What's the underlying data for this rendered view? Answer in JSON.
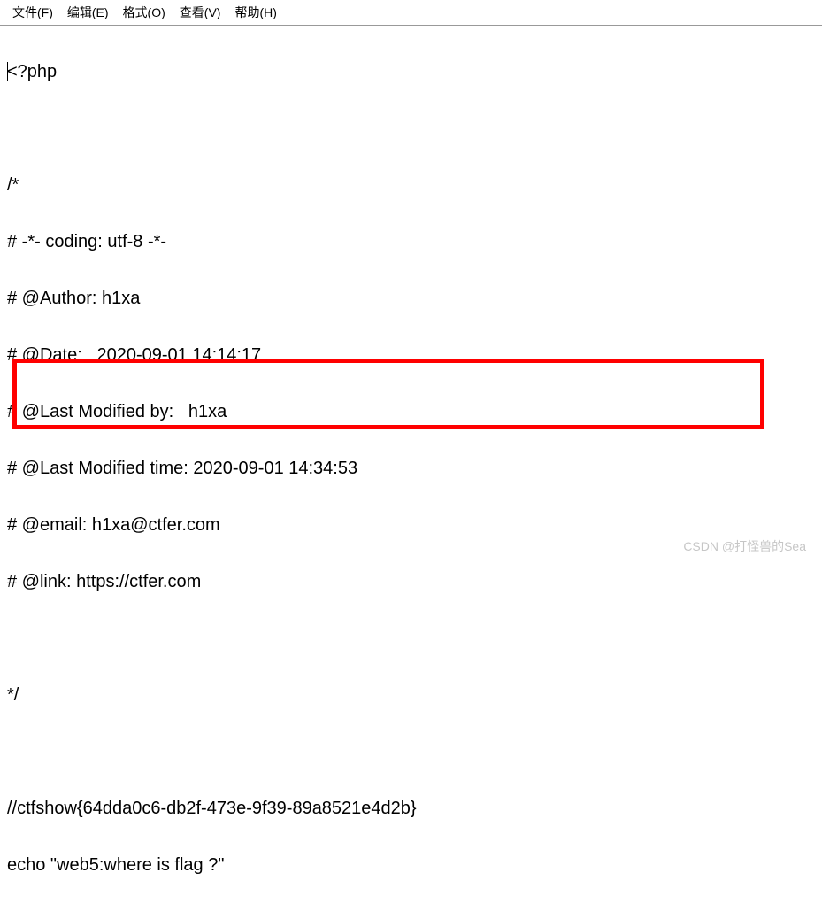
{
  "menubar": {
    "file": "文件(F)",
    "edit": "编辑(E)",
    "format": "格式(O)",
    "view": "查看(V)",
    "help": "帮助(H)"
  },
  "code": {
    "line1": "<?php",
    "line2": "",
    "line3": "/*",
    "line4": "# -*- coding: utf-8 -*-",
    "line5": "# @Author: h1xa",
    "line6": "# @Date:   2020-09-01 14:14:17",
    "line7": "# @Last Modified by:   h1xa",
    "line8": "# @Last Modified time: 2020-09-01 14:34:53",
    "line9": "# @email: h1xa@ctfer.com",
    "line10": "# @link: https://ctfer.com",
    "line11": "",
    "line12": "*/",
    "line13": "",
    "line14": "//ctfshow{64dda0c6-db2f-473e-9f39-89a8521e4d2b}",
    "line15": "echo \"web5:where is flag ?\""
  },
  "watermark": "CSDN @打怪兽的Sea"
}
